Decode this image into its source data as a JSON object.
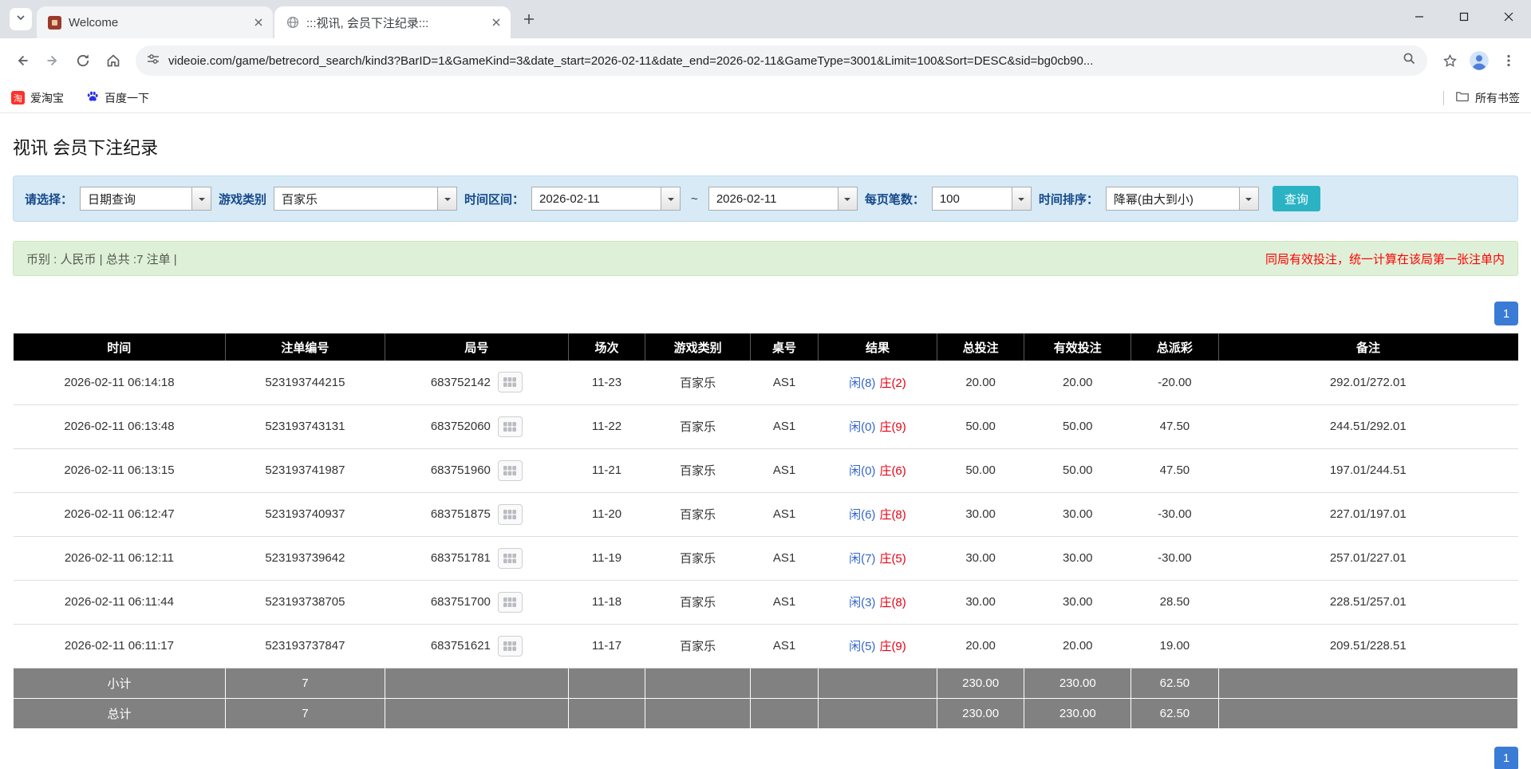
{
  "browser": {
    "tabs": [
      {
        "title": "Welcome"
      },
      {
        "title": ":::视讯, 会员下注纪录:::"
      }
    ],
    "url": "videoie.com/game/betrecord_search/kind3?BarID=1&GameKind=3&date_start=2026-02-11&date_end=2026-02-11&GameType=3001&Limit=100&Sort=DESC&sid=bg0cb90...",
    "bookmarks": [
      {
        "label": "爱淘宝",
        "icon_char": "淘"
      },
      {
        "label": "百度一下"
      }
    ],
    "all_bookmarks_label": "所有书签"
  },
  "page": {
    "title": "视讯 会员下注纪录",
    "filters": {
      "select_label": "请选择：",
      "select_value": "日期查询",
      "game_label": "游戏类别",
      "game_value": "百家乐",
      "range_label": "时间区间：",
      "date_start": "2026-02-11",
      "range_separator": "~",
      "date_end": "2026-02-11",
      "per_page_label": "每页笔数：",
      "per_page_value": "100",
      "sort_label": "时间排序：",
      "sort_value": "降幂(由大到小)",
      "search_button_label": "查询"
    },
    "info_bar": {
      "left": "币别 : 人民币 | 总共 :7 注单 |",
      "right": "同局有效投注，统一计算在该局第一张注单内"
    },
    "pagination": {
      "label": "1"
    },
    "table": {
      "headers": [
        "时间",
        "注单编号",
        "局号",
        "场次",
        "游戏类别",
        "桌号",
        "结果",
        "总投注",
        "有效投注",
        "总派彩",
        "备注"
      ],
      "rows": [
        {
          "time": "2026-02-11 06:14:18",
          "bet_id": "523193744215",
          "round_id": "683752142",
          "session": "11-23",
          "game": "百家乐",
          "table_no": "AS1",
          "result_player": "闲(8)",
          "result_banker": "庄(2)",
          "total_bet": "20.00",
          "valid_bet": "20.00",
          "payout": "-20.00",
          "note": "292.01/272.01"
        },
        {
          "time": "2026-02-11 06:13:48",
          "bet_id": "523193743131",
          "round_id": "683752060",
          "session": "11-22",
          "game": "百家乐",
          "table_no": "AS1",
          "result_player": "闲(0)",
          "result_banker": "庄(9)",
          "total_bet": "50.00",
          "valid_bet": "50.00",
          "payout": "47.50",
          "note": "244.51/292.01"
        },
        {
          "time": "2026-02-11 06:13:15",
          "bet_id": "523193741987",
          "round_id": "683751960",
          "session": "11-21",
          "game": "百家乐",
          "table_no": "AS1",
          "result_player": "闲(0)",
          "result_banker": "庄(6)",
          "total_bet": "50.00",
          "valid_bet": "50.00",
          "payout": "47.50",
          "note": "197.01/244.51"
        },
        {
          "time": "2026-02-11 06:12:47",
          "bet_id": "523193740937",
          "round_id": "683751875",
          "session": "11-20",
          "game": "百家乐",
          "table_no": "AS1",
          "result_player": "闲(6)",
          "result_banker": "庄(8)",
          "total_bet": "30.00",
          "valid_bet": "30.00",
          "payout": "-30.00",
          "note": "227.01/197.01"
        },
        {
          "time": "2026-02-11 06:12:11",
          "bet_id": "523193739642",
          "round_id": "683751781",
          "session": "11-19",
          "game": "百家乐",
          "table_no": "AS1",
          "result_player": "闲(7)",
          "result_banker": "庄(5)",
          "total_bet": "30.00",
          "valid_bet": "30.00",
          "payout": "-30.00",
          "note": "257.01/227.01"
        },
        {
          "time": "2026-02-11 06:11:44",
          "bet_id": "523193738705",
          "round_id": "683751700",
          "session": "11-18",
          "game": "百家乐",
          "table_no": "AS1",
          "result_player": "闲(3)",
          "result_banker": "庄(8)",
          "total_bet": "30.00",
          "valid_bet": "30.00",
          "payout": "28.50",
          "note": "228.51/257.01"
        },
        {
          "time": "2026-02-11 06:11:17",
          "bet_id": "523193737847",
          "round_id": "683751621",
          "session": "11-17",
          "game": "百家乐",
          "table_no": "AS1",
          "result_player": "闲(5)",
          "result_banker": "庄(9)",
          "total_bet": "20.00",
          "valid_bet": "20.00",
          "payout": "19.00",
          "note": "209.51/228.51"
        }
      ],
      "subtotal": {
        "label": "小计",
        "count": "7",
        "total_bet": "230.00",
        "valid_bet": "230.00",
        "payout": "62.50"
      },
      "total": {
        "label": "总计",
        "count": "7",
        "total_bet": "230.00",
        "valid_bet": "230.00",
        "payout": "62.50"
      }
    }
  },
  "colors": {
    "accent_blue": "#3366cc",
    "negative_red": "#e60012",
    "search_button_teal": "#2bb3c4",
    "pagination_blue": "#3a7bd5",
    "filter_bar_bg": "#d7eaf5",
    "info_bar_bg": "#dff0d8",
    "table_header_bg": "#000000",
    "table_footer_bg": "#818181"
  }
}
